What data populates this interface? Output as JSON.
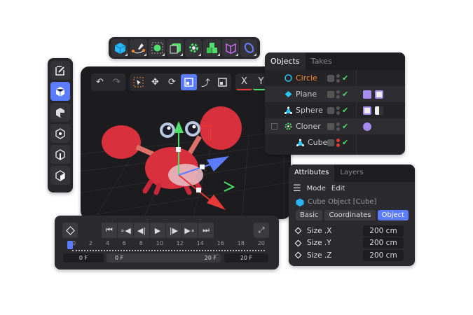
{
  "top_toolbar": {
    "icons": [
      "cube-icon",
      "spline-pen-icon",
      "subdivision-icon",
      "extrude-icon",
      "cloner-icon",
      "volume-icon",
      "deformer-icon",
      "field-icon"
    ]
  },
  "left_toolbar": {
    "icons": [
      "edit-mode-icon",
      "model-mode-icon",
      "texture-mode-icon",
      "point-mode-icon",
      "edge-mode-icon",
      "polygon-mode-icon"
    ],
    "active": 1
  },
  "viewport": {
    "tools": {
      "axis_x": "X",
      "axis_y": "Y"
    }
  },
  "object_manager": {
    "tabs": [
      "Objects",
      "Takes"
    ],
    "objects": [
      {
        "name": "Circle",
        "color": "#ff8a2a",
        "selected": true
      },
      {
        "name": "Plane"
      },
      {
        "name": "Sphere"
      },
      {
        "name": "Cloner"
      },
      {
        "name": "Cube"
      }
    ]
  },
  "attributes": {
    "tabs": [
      "Attributes",
      "Layers"
    ],
    "menu": [
      "Mode",
      "Edit"
    ],
    "object_title": "Cube Object [Cube]",
    "sub_tabs": [
      "Basic",
      "Coordinates",
      "Object"
    ],
    "active_sub_tab": "Object",
    "fields": [
      {
        "label": "Size .X",
        "value": "200 cm"
      },
      {
        "label": "Size .Y",
        "value": "200 cm"
      },
      {
        "label": "Size .Z",
        "value": "200 cm"
      }
    ]
  },
  "timeline": {
    "ticks": [
      "0",
      "2",
      "4",
      "6",
      "8",
      "10",
      "12",
      "14",
      "16",
      "18",
      "20"
    ],
    "current_frame": "0 F",
    "range_start": "0 F",
    "range_end": "20 F",
    "end_frame": "20 F"
  },
  "colors": {
    "accent": "#5b7cff",
    "check": "#4ee06a",
    "panel": "#2b2b2f"
  }
}
